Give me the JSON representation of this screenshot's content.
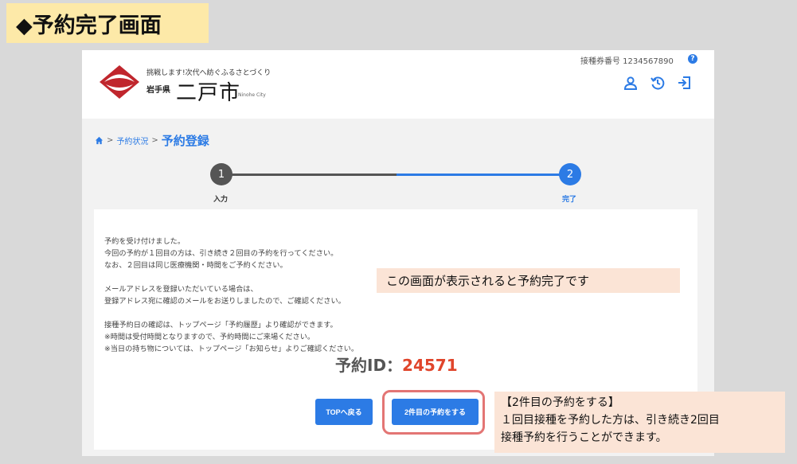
{
  "slide_title": "◆予約完了画面",
  "header": {
    "tagline": "挑戦します!次代へ紡ぐふるさとづくり",
    "prefecture": "岩手県",
    "city": "二戸市",
    "city_en": "Ninohe City",
    "ticket_label": "接種券番号 1234567890",
    "help": "?"
  },
  "breadcrumb": {
    "status": "予約状況",
    "separator": ">",
    "current": "予約登録"
  },
  "steps": [
    {
      "number": "1",
      "label": "入力"
    },
    {
      "number": "2",
      "label": "完了"
    }
  ],
  "message": {
    "p1": "予約を受け付けました。",
    "p2": "今回の予約が１回目の方は、引き続き２回目の予約を行ってください。",
    "p3": "なお、２回目は同じ医療機関・時間をご予約ください。",
    "p4": "メールアドレスを登録いただいている場合は、",
    "p5": "登録アドレス宛に確認のメールをお送りしましたので、ご確認ください。",
    "p6": "接種予約日の確認は、トップページ「予約履歴」より確認ができます。",
    "p7": "※時間は受付時間となりますので、予約時間にご来場ください。",
    "p8": "※当日の持ち物については、トップページ「お知らせ」よりご確認ください。"
  },
  "reservation": {
    "label": "予約ID：",
    "id": "24571"
  },
  "buttons": {
    "top": "TOPへ戻る",
    "second": "2件目の予約をする"
  },
  "callouts": {
    "complete": "この画面が表示されると予約完了です",
    "second_title": "【2件目の予約をする】",
    "second_line1": "１回目接種を予約した方は、引き続き2回目",
    "second_line2": "接種予約を行うことができます。"
  },
  "colors": {
    "accent": "#2c7be5",
    "reservation_id": "#e0452b",
    "callout_bg": "#fbe4d6",
    "title_bg": "#fde9a8",
    "step_inactive": "#555555"
  }
}
